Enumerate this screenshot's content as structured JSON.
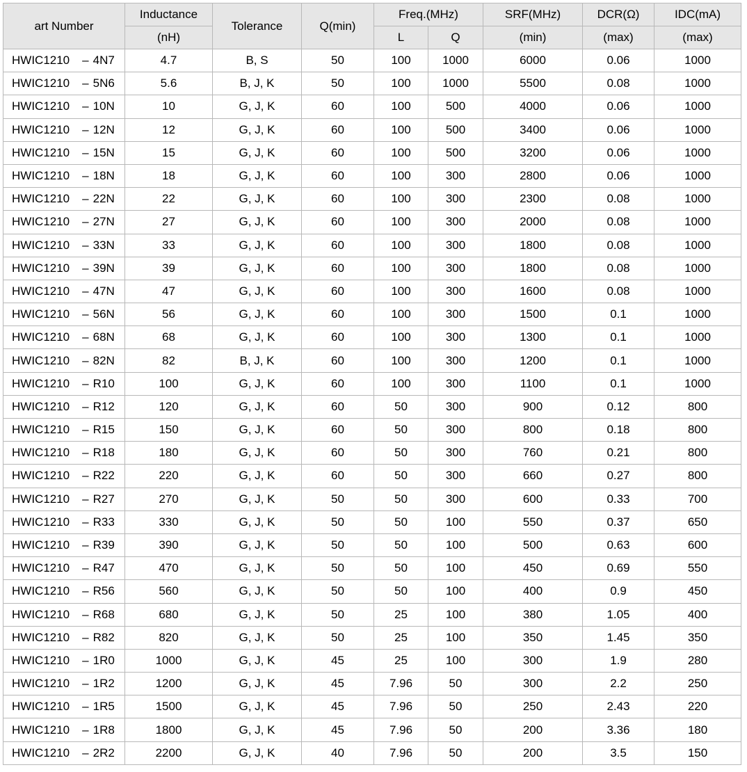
{
  "header": {
    "part_number": "art Number",
    "inductance": [
      "Inductance",
      "(nH)"
    ],
    "tolerance": "Tolerance",
    "q": "Q(min)",
    "freq": "Freq.(MHz)",
    "freq_l": "L",
    "freq_q": "Q",
    "srf": [
      "SRF(MHz)",
      "(min)"
    ],
    "dcr": [
      "DCR(Ω)",
      "(max)"
    ],
    "idc": [
      "IDC(mA)",
      "(max)"
    ]
  },
  "rows": [
    {
      "prefix": "HWIC1210",
      "code": "4N7",
      "inductance": "4.7",
      "tolerance": "B, S",
      "q": "50",
      "freq_l": "100",
      "freq_q": "1000",
      "srf": "6000",
      "dcr": "0.06",
      "idc": "1000"
    },
    {
      "prefix": "HWIC1210",
      "code": "5N6",
      "inductance": "5.6",
      "tolerance": "B, J, K",
      "q": "50",
      "freq_l": "100",
      "freq_q": "1000",
      "srf": "5500",
      "dcr": "0.08",
      "idc": "1000"
    },
    {
      "prefix": "HWIC1210",
      "code": "10N",
      "inductance": "10",
      "tolerance": "G, J, K",
      "q": "60",
      "freq_l": "100",
      "freq_q": "500",
      "srf": "4000",
      "dcr": "0.06",
      "idc": "1000"
    },
    {
      "prefix": "HWIC1210",
      "code": "12N",
      "inductance": "12",
      "tolerance": "G, J, K",
      "q": "60",
      "freq_l": "100",
      "freq_q": "500",
      "srf": "3400",
      "dcr": "0.06",
      "idc": "1000"
    },
    {
      "prefix": "HWIC1210",
      "code": "15N",
      "inductance": "15",
      "tolerance": "G, J, K",
      "q": "60",
      "freq_l": "100",
      "freq_q": "500",
      "srf": "3200",
      "dcr": "0.06",
      "idc": "1000"
    },
    {
      "prefix": "HWIC1210",
      "code": "18N",
      "inductance": "18",
      "tolerance": "G, J, K",
      "q": "60",
      "freq_l": "100",
      "freq_q": "300",
      "srf": "2800",
      "dcr": "0.06",
      "idc": "1000"
    },
    {
      "prefix": "HWIC1210",
      "code": "22N",
      "inductance": "22",
      "tolerance": "G, J, K",
      "q": "60",
      "freq_l": "100",
      "freq_q": "300",
      "srf": "2300",
      "dcr": "0.08",
      "idc": "1000"
    },
    {
      "prefix": "HWIC1210",
      "code": "27N",
      "inductance": "27",
      "tolerance": "G, J, K",
      "q": "60",
      "freq_l": "100",
      "freq_q": "300",
      "srf": "2000",
      "dcr": "0.08",
      "idc": "1000"
    },
    {
      "prefix": "HWIC1210",
      "code": "33N",
      "inductance": "33",
      "tolerance": "G, J, K",
      "q": "60",
      "freq_l": "100",
      "freq_q": "300",
      "srf": "1800",
      "dcr": "0.08",
      "idc": "1000"
    },
    {
      "prefix": "HWIC1210",
      "code": "39N",
      "inductance": "39",
      "tolerance": "G, J, K",
      "q": "60",
      "freq_l": "100",
      "freq_q": "300",
      "srf": "1800",
      "dcr": "0.08",
      "idc": "1000"
    },
    {
      "prefix": "HWIC1210",
      "code": "47N",
      "inductance": "47",
      "tolerance": "G, J, K",
      "q": "60",
      "freq_l": "100",
      "freq_q": "300",
      "srf": "1600",
      "dcr": "0.08",
      "idc": "1000"
    },
    {
      "prefix": "HWIC1210",
      "code": "56N",
      "inductance": "56",
      "tolerance": "G, J, K",
      "q": "60",
      "freq_l": "100",
      "freq_q": "300",
      "srf": "1500",
      "dcr": "0.1",
      "idc": "1000"
    },
    {
      "prefix": "HWIC1210",
      "code": "68N",
      "inductance": "68",
      "tolerance": "G, J, K",
      "q": "60",
      "freq_l": "100",
      "freq_q": "300",
      "srf": "1300",
      "dcr": "0.1",
      "idc": "1000"
    },
    {
      "prefix": "HWIC1210",
      "code": "82N",
      "inductance": "82",
      "tolerance": "B, J, K",
      "q": "60",
      "freq_l": "100",
      "freq_q": "300",
      "srf": "1200",
      "dcr": "0.1",
      "idc": "1000"
    },
    {
      "prefix": "HWIC1210",
      "code": "R10",
      "inductance": "100",
      "tolerance": "G, J, K",
      "q": "60",
      "freq_l": "100",
      "freq_q": "300",
      "srf": "1100",
      "dcr": "0.1",
      "idc": "1000"
    },
    {
      "prefix": "HWIC1210",
      "code": "R12",
      "inductance": "120",
      "tolerance": "G, J, K",
      "q": "60",
      "freq_l": "50",
      "freq_q": "300",
      "srf": "900",
      "dcr": "0.12",
      "idc": "800"
    },
    {
      "prefix": "HWIC1210",
      "code": "R15",
      "inductance": "150",
      "tolerance": "G, J, K",
      "q": "60",
      "freq_l": "50",
      "freq_q": "300",
      "srf": "800",
      "dcr": "0.18",
      "idc": "800"
    },
    {
      "prefix": "HWIC1210",
      "code": "R18",
      "inductance": "180",
      "tolerance": "G, J, K",
      "q": "60",
      "freq_l": "50",
      "freq_q": "300",
      "srf": "760",
      "dcr": "0.21",
      "idc": "800"
    },
    {
      "prefix": "HWIC1210",
      "code": "R22",
      "inductance": "220",
      "tolerance": "G, J, K",
      "q": "60",
      "freq_l": "50",
      "freq_q": "300",
      "srf": "660",
      "dcr": "0.27",
      "idc": "800"
    },
    {
      "prefix": "HWIC1210",
      "code": "R27",
      "inductance": "270",
      "tolerance": "G, J, K",
      "q": "50",
      "freq_l": "50",
      "freq_q": "300",
      "srf": "600",
      "dcr": "0.33",
      "idc": "700"
    },
    {
      "prefix": "HWIC1210",
      "code": "R33",
      "inductance": "330",
      "tolerance": "G, J, K",
      "q": "50",
      "freq_l": "50",
      "freq_q": "100",
      "srf": "550",
      "dcr": "0.37",
      "idc": "650"
    },
    {
      "prefix": "HWIC1210",
      "code": "R39",
      "inductance": "390",
      "tolerance": "G, J, K",
      "q": "50",
      "freq_l": "50",
      "freq_q": "100",
      "srf": "500",
      "dcr": "0.63",
      "idc": "600"
    },
    {
      "prefix": "HWIC1210",
      "code": "R47",
      "inductance": "470",
      "tolerance": "G, J, K",
      "q": "50",
      "freq_l": "50",
      "freq_q": "100",
      "srf": "450",
      "dcr": "0.69",
      "idc": "550"
    },
    {
      "prefix": "HWIC1210",
      "code": "R56",
      "inductance": "560",
      "tolerance": "G, J, K",
      "q": "50",
      "freq_l": "50",
      "freq_q": "100",
      "srf": "400",
      "dcr": "0.9",
      "idc": "450"
    },
    {
      "prefix": "HWIC1210",
      "code": "R68",
      "inductance": "680",
      "tolerance": "G, J, K",
      "q": "50",
      "freq_l": "25",
      "freq_q": "100",
      "srf": "380",
      "dcr": "1.05",
      "idc": "400"
    },
    {
      "prefix": "HWIC1210",
      "code": "R82",
      "inductance": "820",
      "tolerance": "G, J, K",
      "q": "50",
      "freq_l": "25",
      "freq_q": "100",
      "srf": "350",
      "dcr": "1.45",
      "idc": "350"
    },
    {
      "prefix": "HWIC1210",
      "code": "1R0",
      "inductance": "1000",
      "tolerance": "G, J, K",
      "q": "45",
      "freq_l": "25",
      "freq_q": "100",
      "srf": "300",
      "dcr": "1.9",
      "idc": "280"
    },
    {
      "prefix": "HWIC1210",
      "code": "1R2",
      "inductance": "1200",
      "tolerance": "G, J, K",
      "q": "45",
      "freq_l": "7.96",
      "freq_q": "50",
      "srf": "300",
      "dcr": "2.2",
      "idc": "250"
    },
    {
      "prefix": "HWIC1210",
      "code": "1R5",
      "inductance": "1500",
      "tolerance": "G, J, K",
      "q": "45",
      "freq_l": "7.96",
      "freq_q": "50",
      "srf": "250",
      "dcr": "2.43",
      "idc": "220"
    },
    {
      "prefix": "HWIC1210",
      "code": "1R8",
      "inductance": "1800",
      "tolerance": "G, J, K",
      "q": "45",
      "freq_l": "7.96",
      "freq_q": "50",
      "srf": "200",
      "dcr": "3.36",
      "idc": "180"
    },
    {
      "prefix": "HWIC1210",
      "code": "2R2",
      "inductance": "2200",
      "tolerance": "G, J, K",
      "q": "40",
      "freq_l": "7.96",
      "freq_q": "50",
      "srf": "200",
      "dcr": "3.5",
      "idc": "150"
    }
  ]
}
